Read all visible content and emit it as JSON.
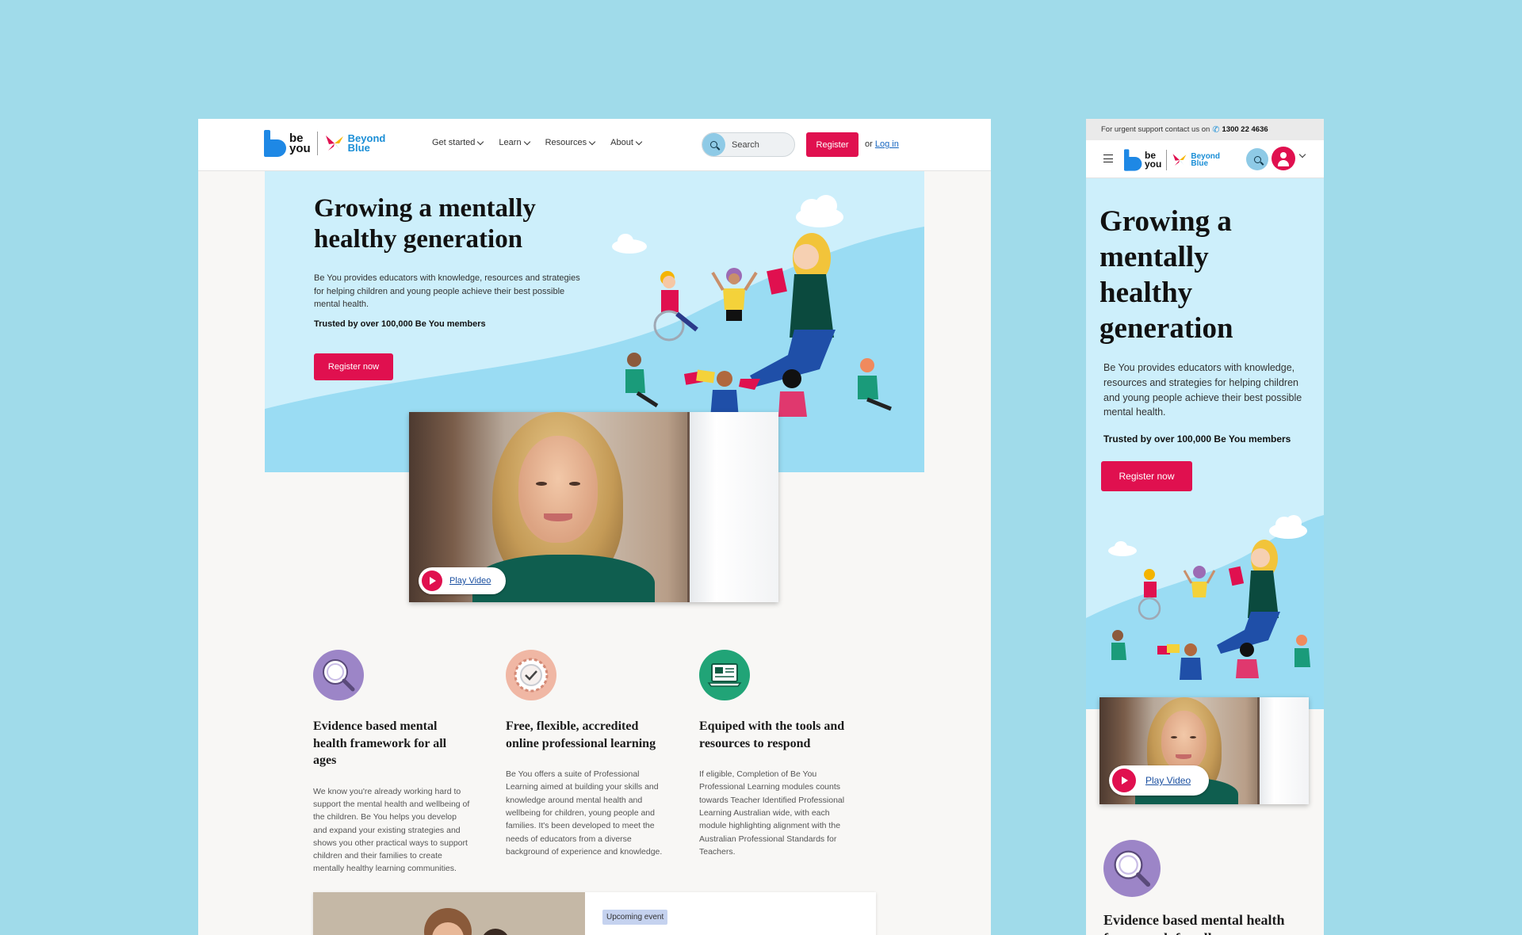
{
  "brand": {
    "be_you_line1": "be",
    "be_you_line2": "you",
    "beyond_blue_line1": "Beyond",
    "beyond_blue_line2": "Blue"
  },
  "nav": {
    "items": [
      {
        "label": "Get started"
      },
      {
        "label": "Learn"
      },
      {
        "label": "Resources"
      },
      {
        "label": "About"
      }
    ],
    "search_label": "Search",
    "register_label": "Register",
    "or_text": "or",
    "login_label": "Log in"
  },
  "hero": {
    "title": "Growing a mentally healthy generation",
    "subtitle": "Be You provides educators with knowledge, resources and strategies for helping children and young people achieve their best possible mental health.",
    "trust": "Trusted by over 100,000 Be You members",
    "cta_label": "Register now"
  },
  "video": {
    "play_label": "Play Video"
  },
  "features": [
    {
      "title": "Evidence based mental health framework for all ages",
      "body": "We know you're already working hard to support the mental health and wellbeing of the children. Be You helps you develop and expand your existing strategies and shows you other practical ways to support children and their families to create mentally healthy learning communities.",
      "icon": "magnifier-icon"
    },
    {
      "title": "Free, flexible, accredited online professional learning",
      "body": "Be You offers a suite of Professional Learning aimed at building your skills and knowledge around mental health and wellbeing for children, young people and families. It's been developed to meet the needs of educators from a diverse background of experience and knowledge.",
      "icon": "certificate-icon"
    },
    {
      "title": "Equiped with the tools and resources to respond",
      "body": "If eligible, Completion of Be You Professional Learning modules counts towards Teacher Identified Professional Learning Australian wide, with each module highlighting alignment with the Australian Professional Standards for Teachers.",
      "icon": "laptop-icon"
    }
  ],
  "event": {
    "badge": "Upcoming event"
  },
  "mobile": {
    "support_text": "For urgent support contact us on",
    "support_phone": "1300 22 4636"
  },
  "colors": {
    "background": "#a0dbea",
    "accent_red": "#e0104f",
    "hero_blue": "#cdeffb",
    "brand_blue": "#1e88e5",
    "purple_icon": "#9c85c7",
    "peach_icon": "#f0b7a4",
    "green_icon": "#21a477"
  }
}
